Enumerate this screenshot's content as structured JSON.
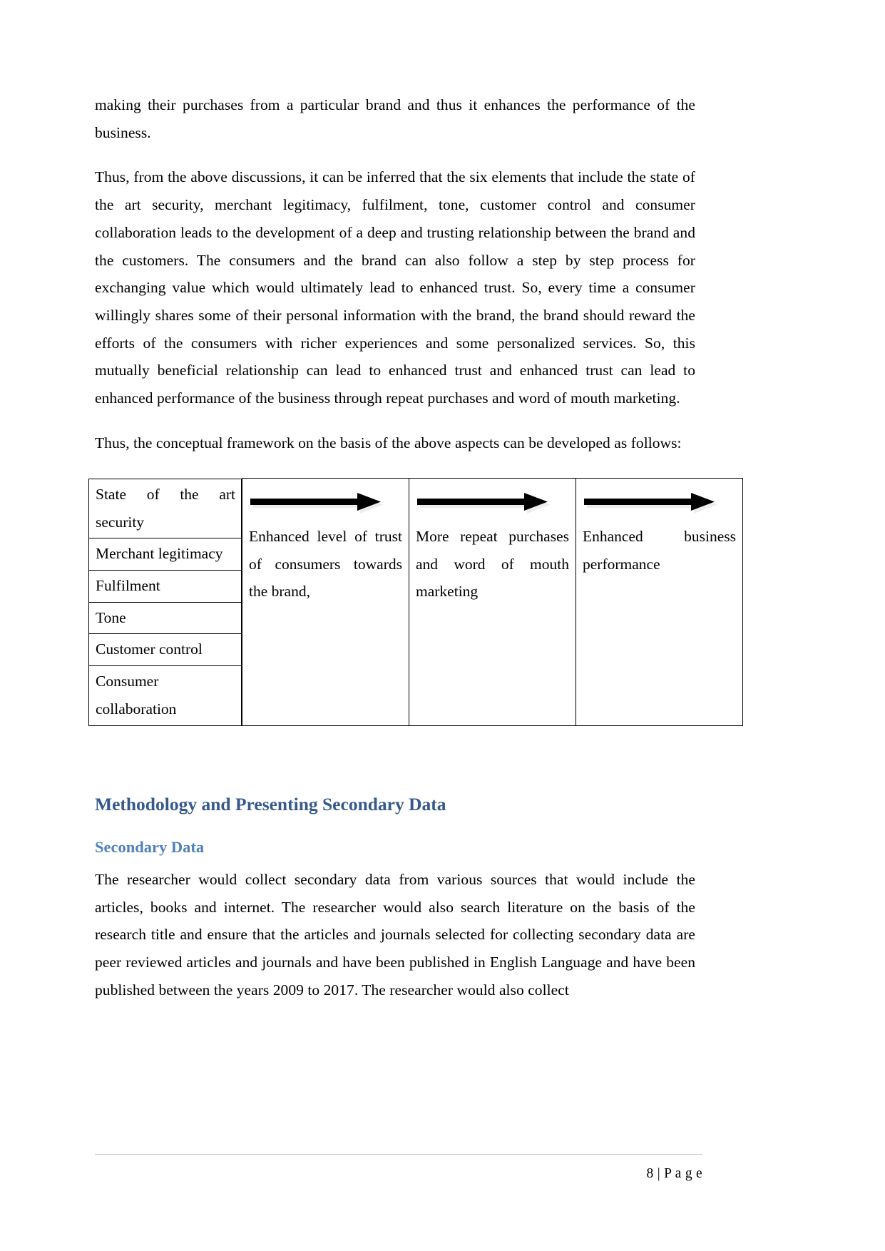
{
  "document": {
    "page_number_footer": "8 | P a g e",
    "paragraphs": [
      "making their purchases from a particular brand and thus it enhances the performance of the business.",
      "Thus, from the above discussions, it can be inferred that the six elements that include the state of the art security, merchant legitimacy, fulfilment, tone, customer control and consumer collaboration leads to the development of a deep and trusting relationship between the brand and the customers. The consumers and the brand can also follow a step by step process for exchanging value which would ultimately lead to enhanced trust. So, every time a consumer willingly shares some of their personal information with the brand, the brand should reward the efforts of the consumers with richer experiences and some personalized services. So, this mutually beneficial relationship can lead to enhanced trust and enhanced trust can lead to enhanced performance of the business through repeat purchases and word of mouth marketing.",
      "Thus, the conceptual framework on the basis of the above aspects can be developed as follows:"
    ],
    "framework_diagram": {
      "elements_column": [
        "State of the art security",
        "Merchant legitimacy",
        "Fulfilment",
        "Tone",
        "Customer control",
        "Consumer collaboration"
      ],
      "stages": [
        "Enhanced level of trust of consumers towards the brand,",
        "More repeat purchases and word of mouth marketing",
        "Enhanced business performance"
      ],
      "arrow_icon": "right-arrow-icon",
      "arrow_color": "#000000",
      "arrow_shadow_color": "#e8e8e8"
    },
    "section_heading": "Methodology and Presenting Secondary Data",
    "sub_heading": "Secondary Data",
    "secondary_data_paragraph": "The researcher would collect secondary data from various sources that would include the articles, books and internet. The researcher would also search literature on the basis of the research title and ensure that the articles and journals selected for collecting secondary data are peer reviewed articles and journals and have been published in English Language and have been published between the years 2009 to 2017. The researcher would also collect",
    "colors": {
      "heading_primary": "#36598C",
      "heading_secondary": "#4E81BC",
      "body_text": "#000000",
      "table_border": "#000000",
      "footer_rule": "#c8c8c8"
    }
  }
}
